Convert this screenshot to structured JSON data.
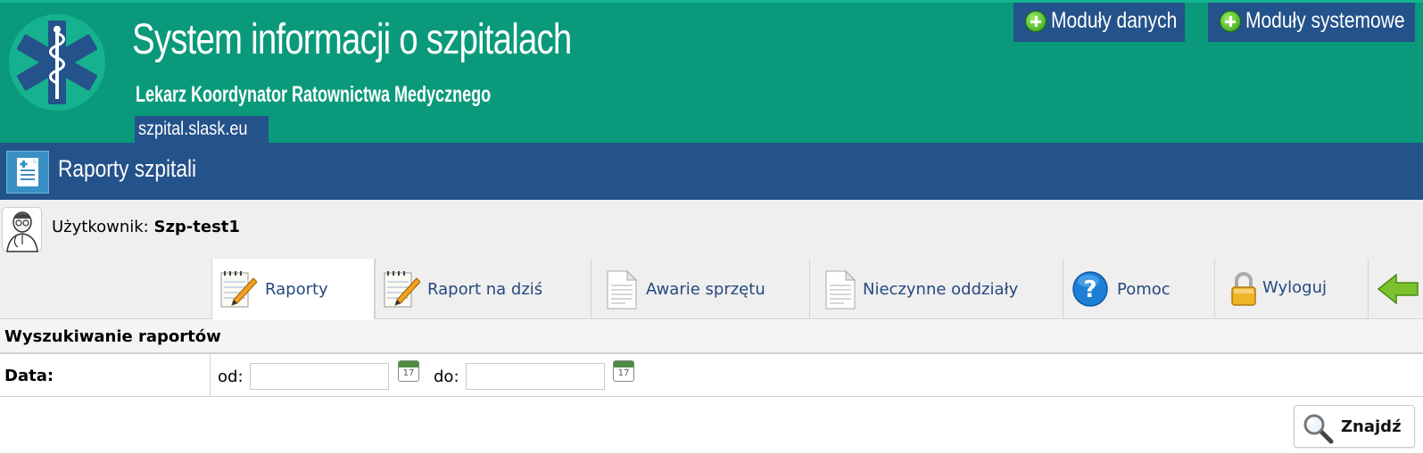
{
  "header": {
    "title": "System informacji o szpitalach",
    "subtitle": "Lekarz Koordynator Ratownictwa Medycznego",
    "domain": "szpital.slask.eu",
    "modules": [
      {
        "label": "Moduły danych"
      },
      {
        "label": "Moduły systemowe"
      }
    ]
  },
  "page": {
    "title": "Raporty szpitali"
  },
  "user": {
    "label": "Użytkownik:",
    "name": "Szp-test1"
  },
  "tabs": [
    {
      "label": "Raporty",
      "icon": "notepad-pencil-icon",
      "active": true
    },
    {
      "label": "Raport na dziś",
      "icon": "notepad-pencil-icon"
    },
    {
      "label": "Awarie sprzętu",
      "icon": "document-icon"
    },
    {
      "label": "Nieczynne oddziały",
      "icon": "document-icon"
    },
    {
      "label": "Pomoc",
      "icon": "help-icon"
    },
    {
      "label": "Wyloguj",
      "icon": "padlock-icon"
    },
    {
      "label": "",
      "icon": "back-arrow-icon"
    }
  ],
  "search": {
    "title": "Wyszukiwanie raportów",
    "date_label": "Data:",
    "from_label": "od:",
    "to_label": "do:",
    "from_value": "",
    "to_value": "",
    "calendar_day": "17",
    "button_label": "Znajdź"
  },
  "colors": {
    "header_bg": "#0a9a7b",
    "nav_blue": "#24528a",
    "tab_text": "#26497e"
  }
}
